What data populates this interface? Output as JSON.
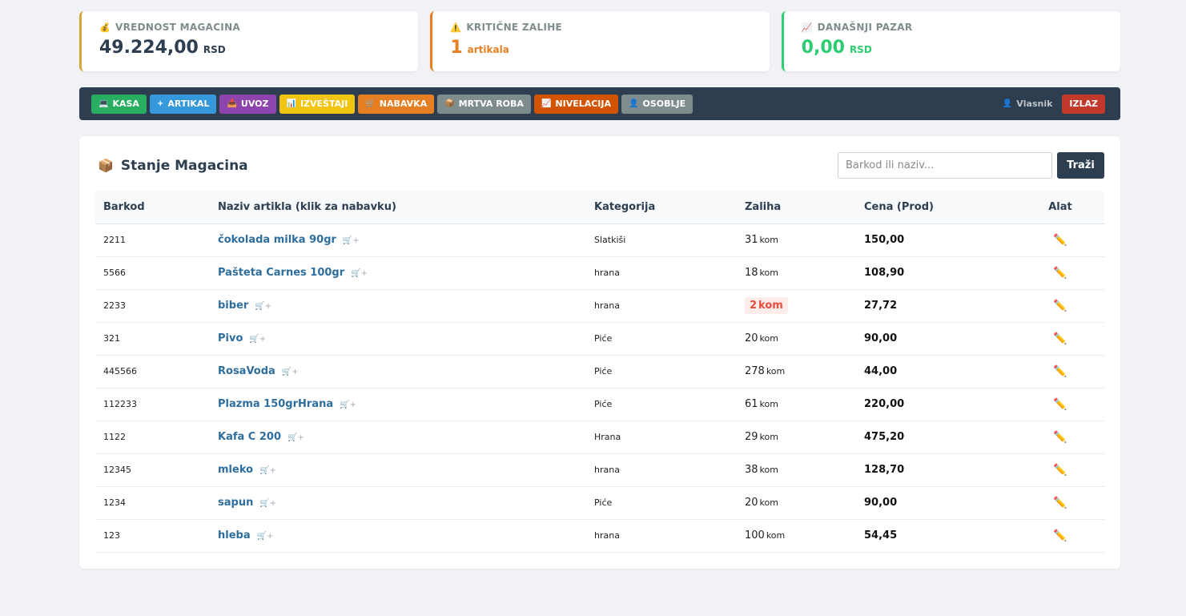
{
  "cards": [
    {
      "icon": "money-bag-icon",
      "glyph": "💰",
      "label": "VREDNOST MAGACINA",
      "value": "49.224,00",
      "unit": "RSD"
    },
    {
      "icon": "warning-icon",
      "glyph": "⚠️",
      "label": "KRITIČNE ZALIHE",
      "value": "1",
      "unit": "artikala"
    },
    {
      "icon": "chart-up-icon",
      "glyph": "📈",
      "label": "DANAŠNJI PAZAR",
      "value": "0,00",
      "unit": "RSD"
    }
  ],
  "toolbar": {
    "buttons": [
      {
        "name": "kasa",
        "glyph": "💻",
        "label": "KASA",
        "color": "#27ae60"
      },
      {
        "name": "artikal",
        "glyph": "+",
        "label": "ARTIKAL",
        "color": "#3498db"
      },
      {
        "name": "uvoz",
        "glyph": "📥",
        "label": "UVOZ",
        "color": "#8e44ad"
      },
      {
        "name": "izvestaji",
        "glyph": "📊",
        "label": "IZVEŠTAJI",
        "color": "#f1c40f"
      },
      {
        "name": "nabavka",
        "glyph": "🛒",
        "label": "NABAVKA",
        "color": "#e67e22"
      },
      {
        "name": "mrtva-roba",
        "glyph": "📦",
        "label": "MRTVA ROBA",
        "color": "#7f8c8d"
      },
      {
        "name": "nivelacija",
        "glyph": "📈",
        "label": "NIVELACIJA",
        "color": "#d35400"
      },
      {
        "name": "osoblje",
        "glyph": "👤",
        "label": "OSOBLJE",
        "color": "#7f8c8d"
      }
    ],
    "user": {
      "glyph": "👤",
      "label": "Vlasnik"
    },
    "logout": {
      "label": "IZLAZ",
      "color": "#c0392b"
    }
  },
  "panel": {
    "title_glyph": "📦",
    "title": "Stanje Magacina",
    "search_placeholder": "Barkod ili naziv...",
    "search_button": "Traži"
  },
  "table": {
    "headers": [
      "Barkod",
      "Naziv artikla (klik za nabavku)",
      "Kategorija",
      "Zaliha",
      "Cena (Prod)",
      "Alat"
    ],
    "cart_glyph": "🛒+",
    "edit_glyph": "✏️",
    "stock_unit": "kom",
    "rows": [
      {
        "barcode": "2211",
        "name": "čokolada milka 90gr",
        "category": "Slatkiši",
        "stock": "31",
        "critical": false,
        "price": "150,00"
      },
      {
        "barcode": "5566",
        "name": "Pašteta Carnes 100gr",
        "category": "hrana",
        "stock": "18",
        "critical": false,
        "price": "108,90"
      },
      {
        "barcode": "2233",
        "name": "biber",
        "category": "hrana",
        "stock": "2",
        "critical": true,
        "price": "27,72"
      },
      {
        "barcode": "321",
        "name": "Pivo",
        "category": "Piće",
        "stock": "20",
        "critical": false,
        "price": "90,00"
      },
      {
        "barcode": "445566",
        "name": "RosaVoda",
        "category": "Piće",
        "stock": "278",
        "critical": false,
        "price": "44,00"
      },
      {
        "barcode": "112233",
        "name": "Plazma 150grHrana",
        "category": "Piće",
        "stock": "61",
        "critical": false,
        "price": "220,00"
      },
      {
        "barcode": "1122",
        "name": "Kafa C 200",
        "category": "Hrana",
        "stock": "29",
        "critical": false,
        "price": "475,20"
      },
      {
        "barcode": "12345",
        "name": "mleko",
        "category": "hrana",
        "stock": "38",
        "critical": false,
        "price": "128,70"
      },
      {
        "barcode": "1234",
        "name": "sapun",
        "category": "Piće",
        "stock": "20",
        "critical": false,
        "price": "90,00"
      },
      {
        "barcode": "123",
        "name": "hleba",
        "category": "hrana",
        "stock": "100",
        "critical": false,
        "price": "54,45"
      }
    ]
  }
}
